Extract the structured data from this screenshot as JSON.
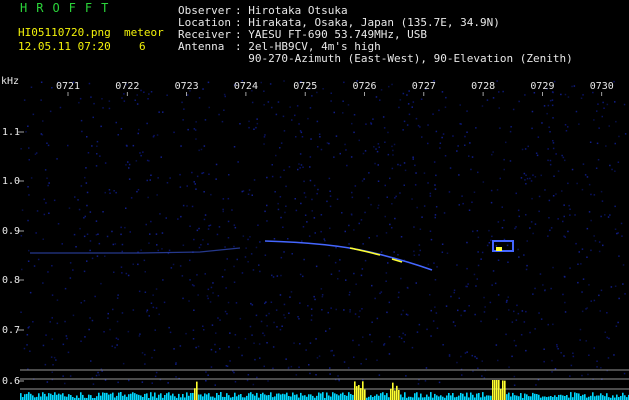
{
  "header": {
    "program": "HROFFT",
    "filename": "HI05110720.png",
    "datetime": "12.05.11 07:20",
    "meteor_label": "meteor",
    "meteor_count": "6",
    "info_labels": [
      "Observer",
      "Location",
      "Receiver",
      "Antenna",
      ""
    ],
    "info_values": [
      ": Hirotaka Otsuka",
      ": Hirakata, Osaka, Japan (135.7E, 34.9N)",
      ": YAESU FT-690 53.749MHz, USB",
      ": 2el-HB9CV, 4m's high",
      "  90-270-Azimuth (East-West), 90-Elevation (Zenith)"
    ]
  },
  "axes": {
    "unit_label": "kHz",
    "time_ticks": [
      "0721",
      "0722",
      "0723",
      "0724",
      "0725",
      "0726",
      "0727",
      "0728",
      "0729",
      "0730"
    ],
    "freq_ticks": [
      "1.1",
      "1.0",
      "0.9",
      "0.8",
      "0.7",
      "0.6"
    ]
  },
  "colors": {
    "background": "#000000",
    "noise": "#08104a",
    "trace": "#4466ff",
    "hot": "#ffff30",
    "histogram": "#00d8ff",
    "grid": "#c8c8c8",
    "text_white": "#e8e8e8",
    "text_yellow": "#f2f20a",
    "text_green": "#2bd43a"
  }
}
